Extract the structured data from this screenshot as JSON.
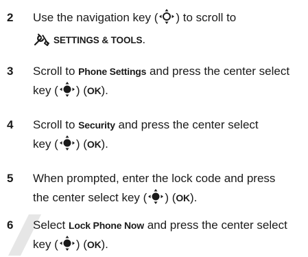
{
  "steps": [
    {
      "number": "2",
      "line1_prefix": "Use the navigation key (",
      "line1_suffix": ") to scroll to",
      "line2_menu": "SETTINGS & TOOLS",
      "line2_suffix": ".",
      "icons": [
        "nav-key-icon",
        "settings-tools-icon"
      ]
    },
    {
      "number": "3",
      "line1_prefix": "Scroll to ",
      "line1_menu": "Phone Settings",
      "line1_suffix": " and press the center select",
      "line2_prefix": "key (",
      "line2_suffix": ") (",
      "line2_ok": "OK",
      "line2_end": ").",
      "icons": [
        "center-select-icon"
      ]
    },
    {
      "number": "4",
      "line1_prefix": "Scroll to ",
      "line1_menu": "Security",
      "line1_suffix": " and press the center select",
      "line2_prefix": "key (",
      "line2_suffix": ") (",
      "line2_ok": "OK",
      "line2_end": ").",
      "icons": [
        "center-select-icon"
      ]
    },
    {
      "number": "5",
      "line1": "When prompted, enter the lock code and press",
      "line2_prefix": "the center select key (",
      "line2_suffix": ") (",
      "line2_ok": "OK",
      "line2_end": ").",
      "icons": [
        "center-select-icon"
      ]
    },
    {
      "number": "6",
      "line1_prefix": "Select ",
      "line1_menu": "Lock Phone Now",
      "line1_suffix": " and press the center select",
      "line2_prefix": "key (",
      "line2_suffix": ") (",
      "line2_ok": "OK",
      "line2_end": ").",
      "icons": [
        "center-select-icon"
      ]
    }
  ],
  "colors": {
    "text": "#1a1a1a",
    "watermark": "#e6e6e6"
  }
}
